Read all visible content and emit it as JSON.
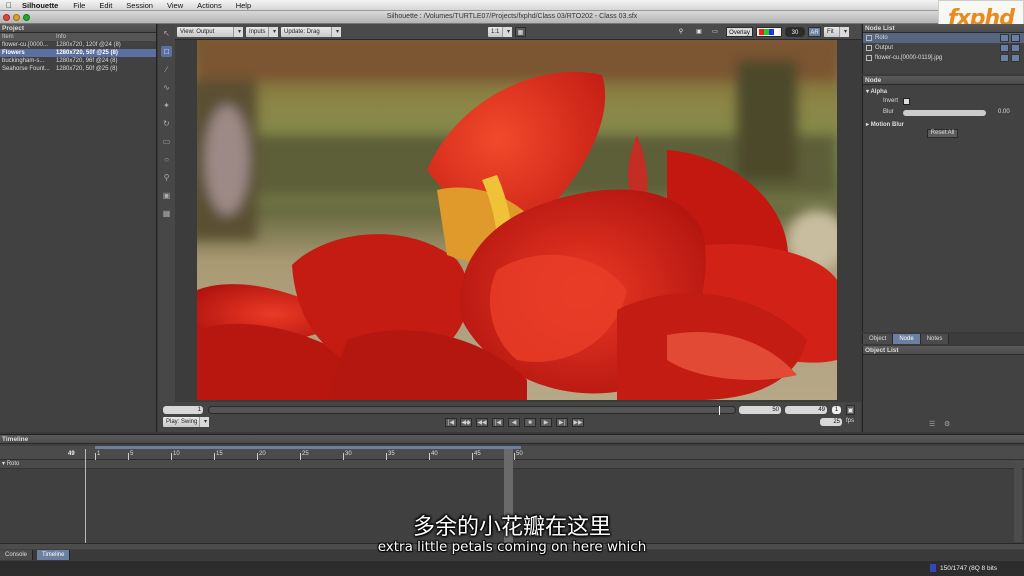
{
  "menubar": {
    "app_name": "Silhouette",
    "items": [
      "File",
      "Edit",
      "Session",
      "View",
      "Actions",
      "Help"
    ]
  },
  "window": {
    "title": "Silhouette : /Volumes/TURTLE07/Projects/fxphd/Class 03/RTO202 - Class 03.sfx"
  },
  "logo_text": "fxphd",
  "project": {
    "panel_title": "Project",
    "col_item": "Item",
    "col_info": "Info",
    "rows": [
      {
        "item": "flower-cu.[0000...",
        "info": "1280x720, 120f @24 (8)"
      },
      {
        "item": "Flowers",
        "info": "1280x720, 50f @25 (8)"
      },
      {
        "item": "buckingham-s...",
        "info": "1280x720, 96f @24 (8)"
      },
      {
        "item": "Seahorse Fount...",
        "info": "1280x720, 50f @25 (8)"
      }
    ]
  },
  "viewer_toolbar": {
    "view": "View: Output",
    "inputs": "Inputs",
    "update": "Update: Drag",
    "zoom": "1:1",
    "overlay": "Overlay",
    "number": "30",
    "ar": "AR",
    "fit": "Fit"
  },
  "viewer_controls": {
    "start_frame": "1",
    "end_frame": "50",
    "current_frame": "49",
    "step": "1",
    "play_mode": "Play: Swing",
    "fps": "25",
    "fps_unit": "fps"
  },
  "node_list": {
    "panel_title": "Node List",
    "items": [
      "Roto",
      "Output",
      "flower-cu.[0000-0119].jpg"
    ]
  },
  "node_panel": {
    "panel_title": "Node",
    "alpha": "Alpha",
    "invert": "Invert",
    "blur": "Blur",
    "blur_value": "0.00",
    "motion_blur": "Motion Blur",
    "reset_all": "Reset All"
  },
  "tabs": [
    "Object",
    "Node",
    "Notes"
  ],
  "object_list": {
    "panel_title": "Object List"
  },
  "timeline": {
    "panel_title": "Timeline",
    "current_frame": "49",
    "ticks": [
      "1",
      "5",
      "10",
      "15",
      "20",
      "25",
      "30",
      "35",
      "40",
      "45",
      "50"
    ],
    "track": "Roto"
  },
  "bottom_tabs": [
    "Console",
    "Timeline"
  ],
  "status": "150/1747 (8Q 8 bits",
  "subtitles": {
    "zh": "多余的小花瓣在这里",
    "en": "extra little petals coming on here which"
  },
  "colors": {
    "accent_blue": "#6c7fa0",
    "flower_red": "#d8231b",
    "logo_orange": "#e98a1c"
  }
}
